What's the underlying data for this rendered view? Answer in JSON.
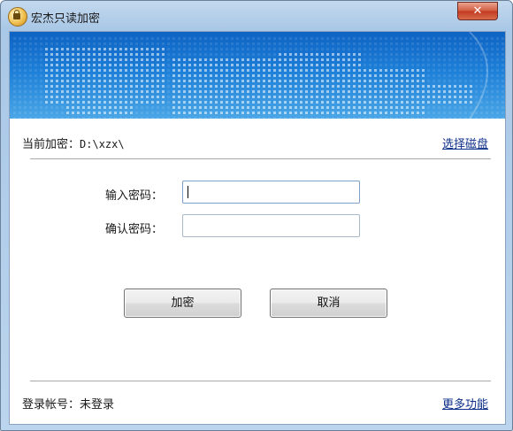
{
  "window": {
    "title": "宏杰只读加密",
    "close_label": "✕"
  },
  "current": {
    "label": "当前加密：",
    "path": "D:\\xzx\\"
  },
  "select_disk_label": "选择磁盘",
  "form": {
    "password_label": "输入密码：",
    "password_value": "",
    "confirm_label": "确认密码：",
    "confirm_value": ""
  },
  "buttons": {
    "encrypt": "加密",
    "cancel": "取消"
  },
  "footer": {
    "account_label": "登录帐号：",
    "account_status": "未登录",
    "more_label": "更多功能"
  },
  "colors": {
    "banner": "#1d7fd8",
    "link": "#0e2f8a"
  },
  "icons": {
    "app": "lock-icon",
    "close": "close-icon"
  }
}
